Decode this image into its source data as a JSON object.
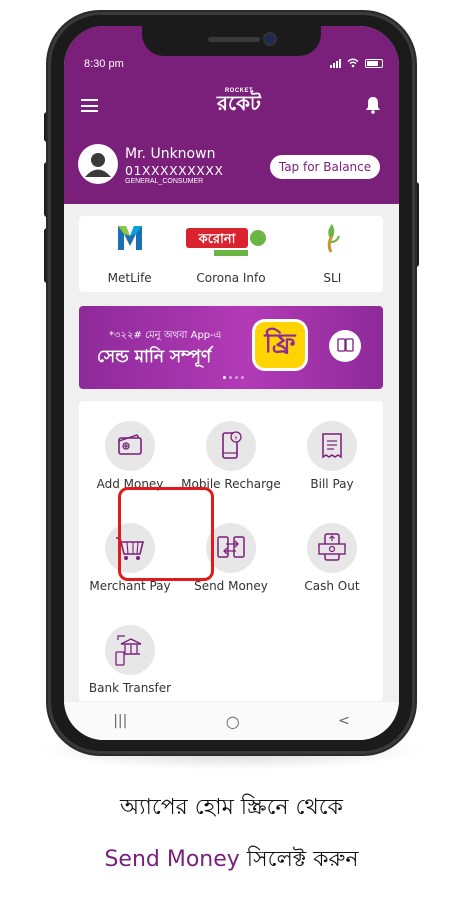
{
  "status_bar": {
    "time": "8:30 pm"
  },
  "header": {
    "logo_small": "ROCKET",
    "logo_big": "রকেট"
  },
  "user": {
    "name": "Mr. Unknown",
    "phone": "01XXXXXXXXX",
    "type": "GENERAL_CONSUMER",
    "balance_button": "Tap for Balance"
  },
  "partners": [
    {
      "label": "MetLife",
      "icon": "metlife-logo"
    },
    {
      "label": "Corona Info",
      "icon": "corona-info-logo"
    },
    {
      "label": "SLI",
      "icon": "sli-logo"
    }
  ],
  "banner": {
    "line1": "*৩২২# মেনু অথবা App-এ",
    "line2": "সেন্ড মানি সম্পূর্ণ",
    "badge": "ফ্রি"
  },
  "services": [
    {
      "label": "Add Money",
      "icon": "wallet-add-icon"
    },
    {
      "label": "Mobile Recharge",
      "icon": "mobile-recharge-icon"
    },
    {
      "label": "Bill Pay",
      "icon": "bill-pay-icon"
    },
    {
      "label": "Merchant Pay",
      "icon": "shopping-cart-icon"
    },
    {
      "label": "Send Money",
      "icon": "send-money-icon"
    },
    {
      "label": "Cash Out",
      "icon": "cash-out-icon"
    },
    {
      "label": "Bank Transfer",
      "icon": "bank-transfer-icon"
    }
  ],
  "nav": {
    "recent": "|||",
    "home": "○",
    "back": "<"
  },
  "caption": {
    "line1": "অ্যাপের হোম স্ক্রিনে থেকে",
    "highlight": "Send Money",
    "line2_rest": " সিলেক্ট করুন"
  },
  "colors": {
    "brand": "#7a1f7a",
    "highlight": "#e11a1a"
  }
}
